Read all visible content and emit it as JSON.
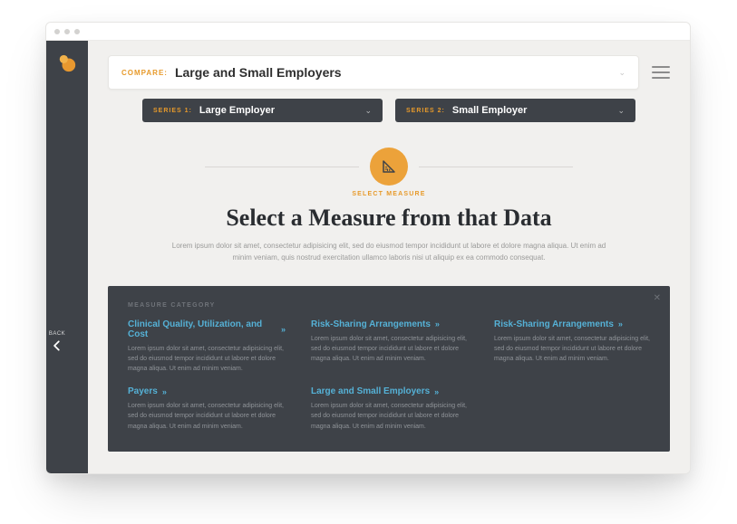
{
  "back": {
    "label": "BACK"
  },
  "compare": {
    "label": "COMPARE:",
    "value": "Large and Small Employers"
  },
  "series": [
    {
      "tag": "SERIES 1:",
      "value": "Large Employer"
    },
    {
      "tag": "SERIES 2:",
      "value": "Small Employer"
    }
  ],
  "hero": {
    "eyebrow": "SELECT MEASURE",
    "title": "Select a Measure from that Data",
    "subtitle": "Lorem ipsum dolor sit amet, consectetur adipisicing elit, sed do eiusmod tempor incididunt ut labore et dolore magna aliqua. Ut enim ad minim veniam, quis nostrud exercitation ullamco laboris nisi ut aliquip ex ea commodo consequat."
  },
  "panel": {
    "eyebrow": "MEASURE CATEGORY",
    "categories": [
      {
        "title": "Clinical Quality, Utilization, and Cost",
        "desc": "Lorem ipsum dolor sit amet, consectetur adipisicing elit, sed do eiusmod tempor incididunt ut labore et dolore magna aliqua. Ut enim ad minim veniam."
      },
      {
        "title": "Risk-Sharing Arrangements",
        "desc": "Lorem ipsum dolor sit amet, consectetur adipisicing elit, sed do eiusmod tempor incididunt ut labore et dolore magna aliqua. Ut enim ad minim veniam."
      },
      {
        "title": "Risk-Sharing Arrangements",
        "desc": "Lorem ipsum dolor sit amet, consectetur adipisicing elit, sed do eiusmod tempor incididunt ut labore et dolore magna aliqua. Ut enim ad minim veniam."
      },
      {
        "title": "Payers",
        "desc": "Lorem ipsum dolor sit amet, consectetur adipisicing elit, sed do eiusmod tempor incididunt ut labore et dolore magna aliqua. Ut enim ad minim veniam."
      },
      {
        "title": "Large and Small Employers",
        "desc": "Lorem ipsum dolor sit amet, consectetur adipisicing elit, sed do eiusmod tempor incididunt ut labore et dolore magna aliqua. Ut enim ad minim veniam."
      }
    ]
  }
}
